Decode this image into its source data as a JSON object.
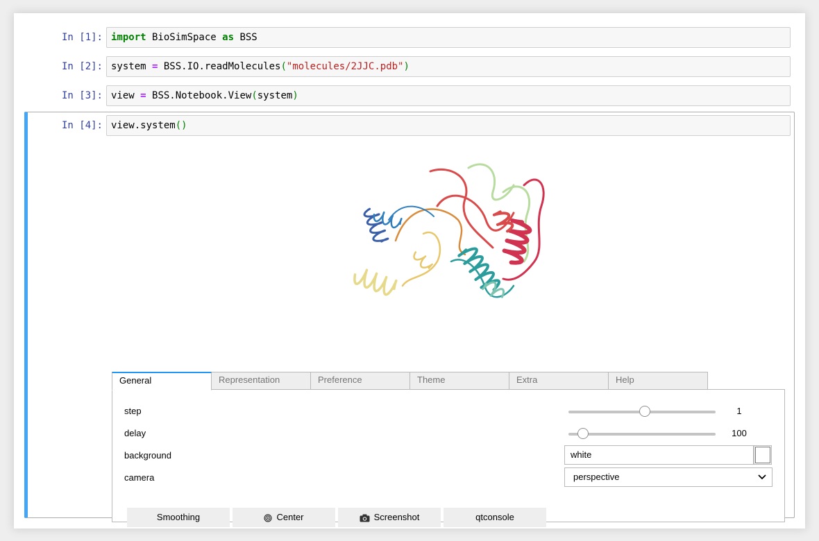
{
  "cells": [
    {
      "prompt": "In [1]:",
      "tokens": [
        {
          "t": "import",
          "c": "kw"
        },
        {
          "t": " BioSimSpace ",
          "c": ""
        },
        {
          "t": "as",
          "c": "kw"
        },
        {
          "t": " BSS",
          "c": ""
        }
      ]
    },
    {
      "prompt": "In [2]:",
      "tokens": [
        {
          "t": "system ",
          "c": ""
        },
        {
          "t": "=",
          "c": "op"
        },
        {
          "t": " BSS.IO.readMolecules",
          "c": ""
        },
        {
          "t": "(",
          "c": "paren"
        },
        {
          "t": "\"molecules/2JJC.pdb\"",
          "c": "str"
        },
        {
          "t": ")",
          "c": "paren"
        }
      ]
    },
    {
      "prompt": "In [3]:",
      "tokens": [
        {
          "t": "view ",
          "c": ""
        },
        {
          "t": "=",
          "c": "op"
        },
        {
          "t": " BSS.Notebook.View",
          "c": ""
        },
        {
          "t": "(",
          "c": "paren"
        },
        {
          "t": "system",
          "c": ""
        },
        {
          "t": ")",
          "c": "paren"
        }
      ]
    },
    {
      "prompt": "In [4]:",
      "tokens": [
        {
          "t": "view.system",
          "c": ""
        },
        {
          "t": "()",
          "c": "paren"
        }
      ]
    }
  ],
  "viewer": {
    "background": "#ffffff",
    "palette": [
      "#3b5ea8",
      "#2f7fbf",
      "#e6d98a",
      "#e8c66a",
      "#d98c3c",
      "#2a9c9c",
      "#7cc4b0",
      "#b8dca0",
      "#d94a4a",
      "#d1324f"
    ]
  },
  "widget": {
    "tabs": [
      "General",
      "Representation",
      "Preference",
      "Theme",
      "Extra",
      "Help"
    ],
    "active_tab": "General",
    "general": {
      "step": {
        "label": "step",
        "value": "1",
        "fraction": 0.52
      },
      "delay": {
        "label": "delay",
        "value": "100",
        "fraction": 0.1
      },
      "background": {
        "label": "background",
        "value": "white"
      },
      "camera": {
        "label": "camera",
        "value": "perspective"
      }
    },
    "buttons": [
      {
        "label": "Smoothing",
        "icon": ""
      },
      {
        "label": "Center",
        "icon": "bullseye-icon"
      },
      {
        "label": "Screenshot",
        "icon": "camera-icon"
      },
      {
        "label": "qtconsole",
        "icon": ""
      }
    ]
  },
  "colors": {
    "accent": "#42a5f5",
    "prompt": "#303f9f",
    "tab_active": "#2196f3"
  }
}
